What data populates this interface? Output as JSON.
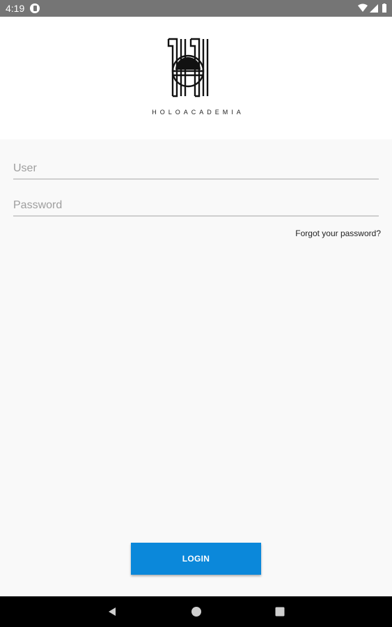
{
  "status_bar": {
    "time": "4:19",
    "icons": [
      "notification-icon",
      "wifi-icon",
      "signal-icon",
      "battery-icon"
    ]
  },
  "header": {
    "logo_text": "HOLOACADEMIA"
  },
  "form": {
    "user_placeholder": "User",
    "password_placeholder": "Password",
    "forgot_label": "Forgot your password?",
    "login_label": "LOGIN"
  },
  "colors": {
    "status_bar": "#757575",
    "primary": "#0b88da",
    "background": "#f9f9f9",
    "nav_bar": "#000000"
  },
  "nav_bar": {
    "buttons": [
      "back-icon",
      "home-icon",
      "recents-icon"
    ]
  }
}
